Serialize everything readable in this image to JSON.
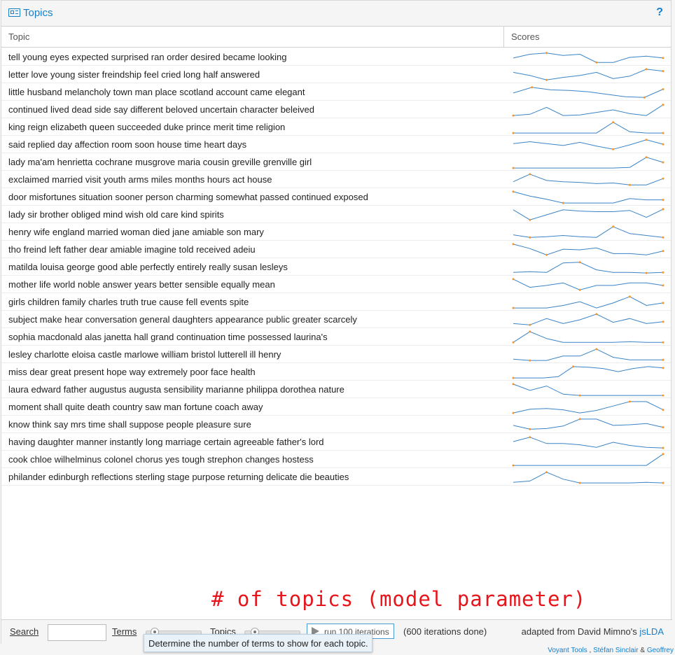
{
  "app": {
    "title": "Topics",
    "help_label": "?"
  },
  "columns": {
    "topic": "Topic",
    "scores": "Scores"
  },
  "spark_colors": {
    "line": "#3a84c6",
    "dot": "#f5962a"
  },
  "topics": [
    {
      "label": "tell young eyes expected surprised ran order desired became looking",
      "scores": [
        0.45,
        0.75,
        0.85,
        0.65,
        0.75,
        0.1,
        0.1,
        0.5,
        0.6,
        0.45
      ]
    },
    {
      "label": "letter love young sister freindship feel cried long half answered",
      "scores": [
        0.7,
        0.45,
        0.1,
        0.3,
        0.45,
        0.7,
        0.2,
        0.4,
        0.95,
        0.8
      ]
    },
    {
      "label": "little husband melancholy town man place scotland account came elegant",
      "scores": [
        0.45,
        0.9,
        0.7,
        0.65,
        0.55,
        0.35,
        0.15,
        0.1,
        0.75
      ]
    },
    {
      "label": "continued lived dead side say different beloved uncertain character beleived",
      "scores": [
        0.05,
        0.15,
        0.7,
        0.05,
        0.1,
        0.3,
        0.5,
        0.2,
        0.05,
        0.9
      ]
    },
    {
      "label": "king reign elizabeth queen succeeded duke prince merit time religion",
      "scores": [
        0.05,
        0.05,
        0.05,
        0.05,
        0.05,
        0.05,
        0.9,
        0.15,
        0.05,
        0.05
      ]
    },
    {
      "label": "said replied day affection room soon house time heart days",
      "scores": [
        0.6,
        0.75,
        0.6,
        0.45,
        0.7,
        0.4,
        0.15,
        0.5,
        0.9,
        0.55
      ]
    },
    {
      "label": "lady ma'am henrietta cochrane musgrove maria cousin greville grenville girl",
      "scores": [
        0.05,
        0.05,
        0.05,
        0.05,
        0.05,
        0.05,
        0.05,
        0.1,
        0.9,
        0.5
      ]
    },
    {
      "label": "exclaimed married visit youth arms miles months hours act house",
      "scores": [
        0.35,
        0.95,
        0.45,
        0.35,
        0.3,
        0.2,
        0.25,
        0.1,
        0.1,
        0.6
      ]
    },
    {
      "label": "door misfortunes situation sooner person charming somewhat passed continued exposed",
      "scores": [
        0.95,
        0.6,
        0.35,
        0.05,
        0.05,
        0.05,
        0.05,
        0.4,
        0.3,
        0.3
      ]
    },
    {
      "label": "lady sir brother obliged mind wish old care kind spirits",
      "scores": [
        0.9,
        0.1,
        0.5,
        0.9,
        0.8,
        0.75,
        0.75,
        0.85,
        0.3,
        0.95
      ]
    },
    {
      "label": "henry wife england married woman died jane amiable son mary",
      "scores": [
        0.3,
        0.1,
        0.15,
        0.25,
        0.15,
        0.1,
        0.95,
        0.4,
        0.25,
        0.1
      ]
    },
    {
      "label": "tho freind left father dear amiable imagine told received adeiu",
      "scores": [
        0.95,
        0.6,
        0.1,
        0.55,
        0.5,
        0.65,
        0.2,
        0.2,
        0.1,
        0.4
      ]
    },
    {
      "label": "matilda louisa george good able perfectly entirely really susan lesleys",
      "scores": [
        0.1,
        0.15,
        0.1,
        0.85,
        0.9,
        0.3,
        0.1,
        0.1,
        0.05,
        0.1
      ]
    },
    {
      "label": "mother life world noble answer years better sensible equally mean",
      "scores": [
        0.95,
        0.3,
        0.45,
        0.65,
        0.1,
        0.45,
        0.45,
        0.65,
        0.65,
        0.45
      ]
    },
    {
      "label": "girls children family charles truth true cause fell events spite",
      "scores": [
        0.05,
        0.05,
        0.05,
        0.25,
        0.55,
        0.05,
        0.45,
        0.95,
        0.25,
        0.45
      ]
    },
    {
      "label": "subject make hear conversation general daughters appearance public greater scarcely",
      "scores": [
        0.2,
        0.1,
        0.6,
        0.2,
        0.5,
        0.95,
        0.3,
        0.6,
        0.2,
        0.35
      ]
    },
    {
      "label": "sophia macdonald alas janetta hall grand continuation time possessed laurina's",
      "scores": [
        0.1,
        0.95,
        0.4,
        0.1,
        0.1,
        0.1,
        0.1,
        0.15,
        0.1,
        0.1
      ]
    },
    {
      "label": "lesley charlotte eloisa castle marlowe william bristol lutterell ill henry",
      "scores": [
        0.15,
        0.05,
        0.05,
        0.4,
        0.4,
        0.95,
        0.3,
        0.1,
        0.1,
        0.1
      ]
    },
    {
      "label": "miss dear great present hope way extremely poor face health",
      "scores": [
        0.05,
        0.05,
        0.05,
        0.15,
        0.95,
        0.9,
        0.8,
        0.55,
        0.8,
        0.95,
        0.85
      ]
    },
    {
      "label": "laura edward father augustus augusta sensibility marianne philippa dorothea nature",
      "scores": [
        0.95,
        0.45,
        0.8,
        0.15,
        0.05,
        0.05,
        0.05,
        0.05,
        0.05,
        0.05
      ]
    },
    {
      "label": "moment shall quite death country saw man fortune coach away",
      "scores": [
        0.05,
        0.35,
        0.4,
        0.3,
        0.05,
        0.25,
        0.6,
        0.95,
        0.95,
        0.3
      ]
    },
    {
      "label": "know think say mrs time shall suppose people pleasure sure",
      "scores": [
        0.45,
        0.15,
        0.2,
        0.4,
        0.95,
        0.95,
        0.45,
        0.5,
        0.6,
        0.3
      ]
    },
    {
      "label": "having daughter manner instantly long marriage certain agreeable father's lord",
      "scores": [
        0.55,
        0.9,
        0.4,
        0.4,
        0.3,
        0.1,
        0.5,
        0.25,
        0.1,
        0.05
      ]
    },
    {
      "label": "cook chloe wilhelminus colonel chorus yes tough strephon changes hostess",
      "scores": [
        0.05,
        0.05,
        0.05,
        0.05,
        0.05,
        0.05,
        0.05,
        0.05,
        0.05,
        0.95
      ]
    },
    {
      "label": "philander edinburgh reflections sterling stage purpose returning delicate die beauties",
      "scores": [
        0.1,
        0.2,
        0.9,
        0.35,
        0.05,
        0.05,
        0.05,
        0.05,
        0.1,
        0.05
      ]
    }
  ],
  "annotation": "# of topics (model parameter)",
  "toolbar": {
    "search_label": "Search",
    "search_value": "",
    "terms_label": "Terms",
    "topics_label": "Topics",
    "run_label": "run 100 iterations",
    "iterations_status": "(600 iterations done)",
    "credit_prefix": "adapted from David Mimno's ",
    "credit_link": "jsLDA"
  },
  "tooltip": "Determine the number of terms to show for each topic.",
  "footer": {
    "tool": "Voyant Tools",
    "sep": " , ",
    "author1": "Stéfan Sinclair",
    "amp": " & ",
    "author2": "Geoffrey"
  }
}
